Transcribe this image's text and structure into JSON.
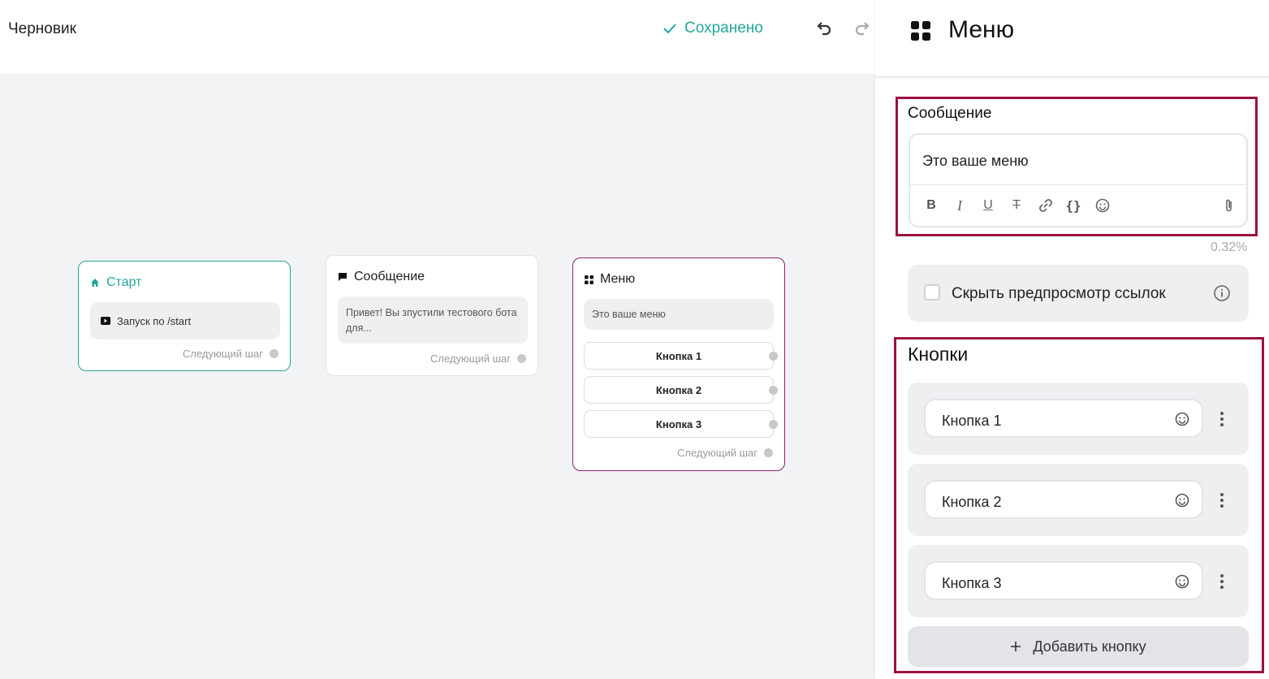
{
  "header": {
    "title": "Черновик",
    "save_status": "Сохранено",
    "undo_icon": "undo-icon",
    "redo_icon": "redo-icon"
  },
  "canvas": {
    "nodes": [
      {
        "title": "Старт",
        "icon": "home-icon",
        "body": "Запуск по /start",
        "body_icon": "play-icon",
        "next": "Следующий шаг"
      },
      {
        "title": "Сообщение",
        "icon": "message-icon",
        "body": "Привет! Вы зпустили тестового бота для...",
        "next": "Следующий шаг"
      },
      {
        "title": "Меню",
        "icon": "menu-grid-icon",
        "body": "Это ваше меню",
        "buttons": [
          "Кнопка 1",
          "Кнопка 2",
          "Кнопка 3"
        ],
        "next": "Следующий шаг"
      }
    ]
  },
  "panel": {
    "title": "Меню",
    "message_label": "Сообщение",
    "message_text": "Это ваше меню",
    "toolbar": [
      "bold-icon",
      "italic-icon",
      "underline-icon",
      "strikethrough-icon",
      "link-icon",
      "code-icon",
      "emoji-icon",
      "attach-icon"
    ],
    "char_usage": "0.32%",
    "hide_preview_label": "Скрыть предпросмотр ссылок",
    "hide_preview_checked": false,
    "buttons_label": "Кнопки",
    "buttons": [
      "Кнопка 1",
      "Кнопка 2",
      "Кнопка 3"
    ],
    "add_button_label": "Добавить кнопку"
  },
  "colors": {
    "accent_teal": "#26a69a",
    "menu_border": "#8e1f6b",
    "highlight": "#9b1044",
    "canvas_bg": "#f2f3f5"
  }
}
